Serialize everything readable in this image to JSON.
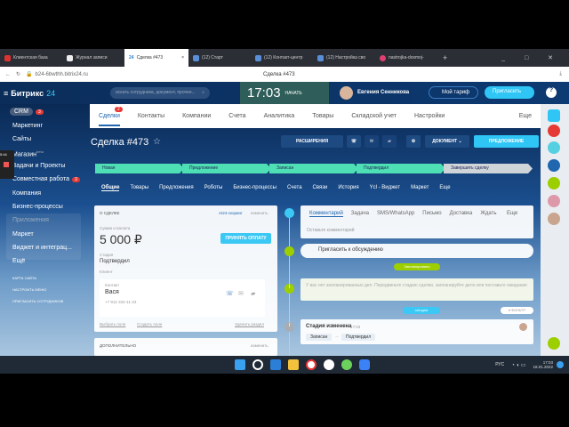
{
  "browser": {
    "tabs": [
      "Клиентская база",
      "Журнал записи",
      "Сделка #473",
      "(12) Старт",
      "(12) Контакт-центр",
      "(12) Настройка сво",
      "nastrojka-dosmoj-"
    ],
    "active_tab": 2,
    "url": "b24-6bwthh.bitrix24.ru",
    "page_title": "Сделка #473"
  },
  "header": {
    "logo": "Битрикс",
    "logo_num": "24",
    "search_placeholder": "искать сотрудника, документ, прочее...",
    "time": "17:03",
    "start": "НАЧАТЬ",
    "user": "Евгения Сенникова",
    "tariff": "Мой тариф",
    "invite": "Пригласить",
    "help_badge": "5"
  },
  "sidebar": {
    "crm": "CRM",
    "crm_badge": "3",
    "items": [
      "Маркетинг",
      "Сайты",
      "Магазин",
      "Задачи и Проекты",
      "Совместная работа",
      "Компания",
      "Бизнес-процессы"
    ],
    "beta": "beta",
    "collab_badge": "3",
    "apps_header": "Приложения",
    "apps": [
      "Маркет",
      "Виджет и интеграц..."
    ],
    "more": "Ещё",
    "links": [
      "КАРТА САЙТА",
      "НАСТРОИТЬ МЕНЮ",
      "ПРИГЛАСИТЬ СОТРУДНИКОВ"
    ],
    "overlay_time": "5:44"
  },
  "crm_tabs": {
    "items": [
      "Сделки",
      "Контакты",
      "Компании",
      "Счета",
      "Аналитика",
      "Товары",
      "Складской учет",
      "Настройки"
    ],
    "badge": "2",
    "more": "Еще"
  },
  "deal": {
    "title": "Сделка #473",
    "extensions": "РАСШИРЕНИЯ",
    "document": "ДОКУМЕНТ",
    "proposal": "ПРЕДЛОЖЕНИЕ",
    "stages": [
      "Новая",
      "Предложение",
      "Записан",
      "Подтвердил",
      "Завершить сделку"
    ],
    "tabs": [
      "Общие",
      "Товары",
      "Предложения",
      "Роботы",
      "Бизнес-процессы",
      "Счета",
      "Связи",
      "История",
      "Ycl - Виджет",
      "Маркет",
      "Еще"
    ]
  },
  "about": {
    "header": "О СДЕЛКЕ",
    "scoring": "АI24-скоринг",
    "edit": "изменить",
    "sum_label": "Сумма и валюта",
    "sum": "5 000 ₽",
    "pay": "ПРИНЯТЬ ОПЛАТУ",
    "stage_label": "Стадия",
    "stage": "Подтвердил",
    "client_label": "Клиент",
    "contact_label": "Контакт",
    "contact_name": "Вася",
    "phone": "+7 912 332-11-23",
    "choose_field": "Выбрать поле",
    "create_field": "Создать поле",
    "delete_section": "Удалить раздел",
    "extra": "ДОПОЛНИТЕЛЬНО",
    "extra_edit": "изменить"
  },
  "timeline": {
    "tabs": [
      "Комментарий",
      "Задача",
      "SMS/WhatsApp",
      "Письмо",
      "Доставка",
      "Ждать",
      "Еще"
    ],
    "comment_placeholder": "Оставьте комментарий",
    "invite": "Пригласить к обсуждению",
    "planned": "Запланировано",
    "no_tasks": "У вас нет запланированных дел. Передвиньте стадию сделки, запланируйте дело или поставьте ожидание",
    "today": "сегодня",
    "filter": "ФИЛЬТР",
    "event_title": "Стадия изменена",
    "event_time": "17:03",
    "from": "Записан",
    "to": "Подтвердил"
  },
  "taskbar": {
    "lang": "РУС",
    "time": "17:03",
    "date": "18.01.2022"
  },
  "colors": {
    "header": "#0b2d5a",
    "stage": "#4ee0b4",
    "accent": "#2fc6f6",
    "badge": "#e53935"
  }
}
